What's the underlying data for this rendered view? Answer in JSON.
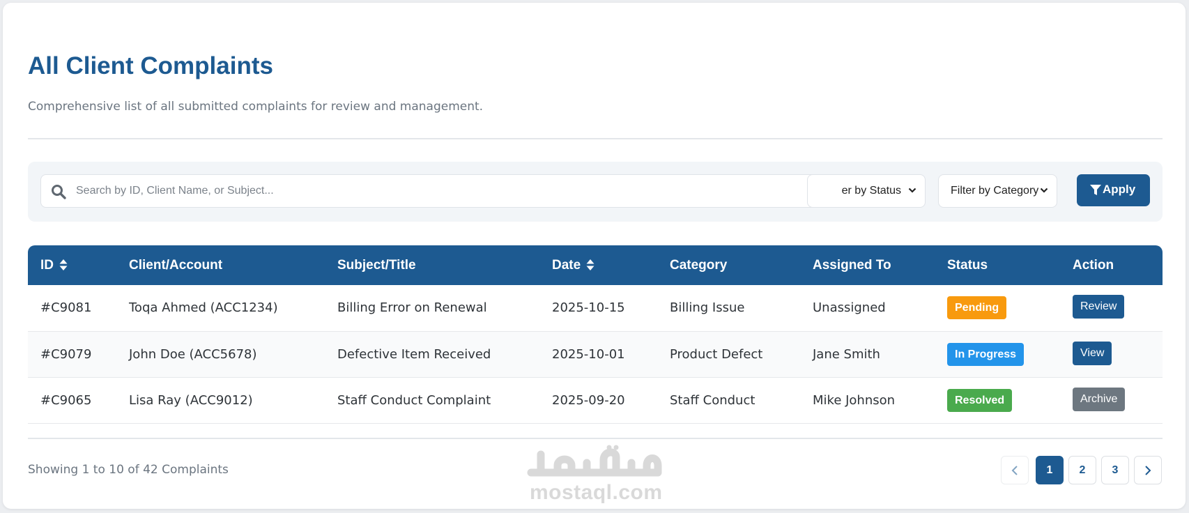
{
  "header": {
    "title": "All Client Complaints",
    "subtitle": "Comprehensive list of all submitted complaints for review and management."
  },
  "filters": {
    "search_placeholder": "Search by ID, Client Name, or Subject...",
    "status_select": "Filter by Status",
    "status_visible_text": "er by Status",
    "category_select": "Filter by Category",
    "apply_label": "Apply"
  },
  "table": {
    "columns": [
      "ID",
      "Client/Account",
      "Subject/Title",
      "Date",
      "Category",
      "Assigned To",
      "Status",
      "Action"
    ],
    "rows": [
      {
        "id": "#C9081",
        "client": "Toqa Ahmed (ACC1234)",
        "subject": "Billing Error on Renewal",
        "date": "2025-10-15",
        "category": "Billing Issue",
        "assigned": "Unassigned",
        "status": "Pending",
        "action": "Review"
      },
      {
        "id": "#C9079",
        "client": "John Doe (ACC5678)",
        "subject": "Defective Item Received",
        "date": "2025-10-01",
        "category": "Product Defect",
        "assigned": "Jane Smith",
        "status": "In Progress",
        "action": "View"
      },
      {
        "id": "#C9065",
        "client": "Lisa Ray (ACC9012)",
        "subject": "Staff Conduct Complaint",
        "date": "2025-09-20",
        "category": "Staff Conduct",
        "assigned": "Mike Johnson",
        "status": "Resolved",
        "action": "Archive"
      }
    ]
  },
  "footer": {
    "showing": "Showing 1 to 10 of 42 Complaints",
    "pages": [
      "1",
      "2",
      "3"
    ],
    "current_page": "1"
  },
  "watermark": {
    "arabic": "مستقل",
    "latin": "mostaql.com"
  },
  "colors": {
    "primary": "#1d5a91",
    "pending": "#f89a0e",
    "in_progress": "#2394ea",
    "resolved": "#4aaa4d",
    "archive": "#6d7780"
  }
}
